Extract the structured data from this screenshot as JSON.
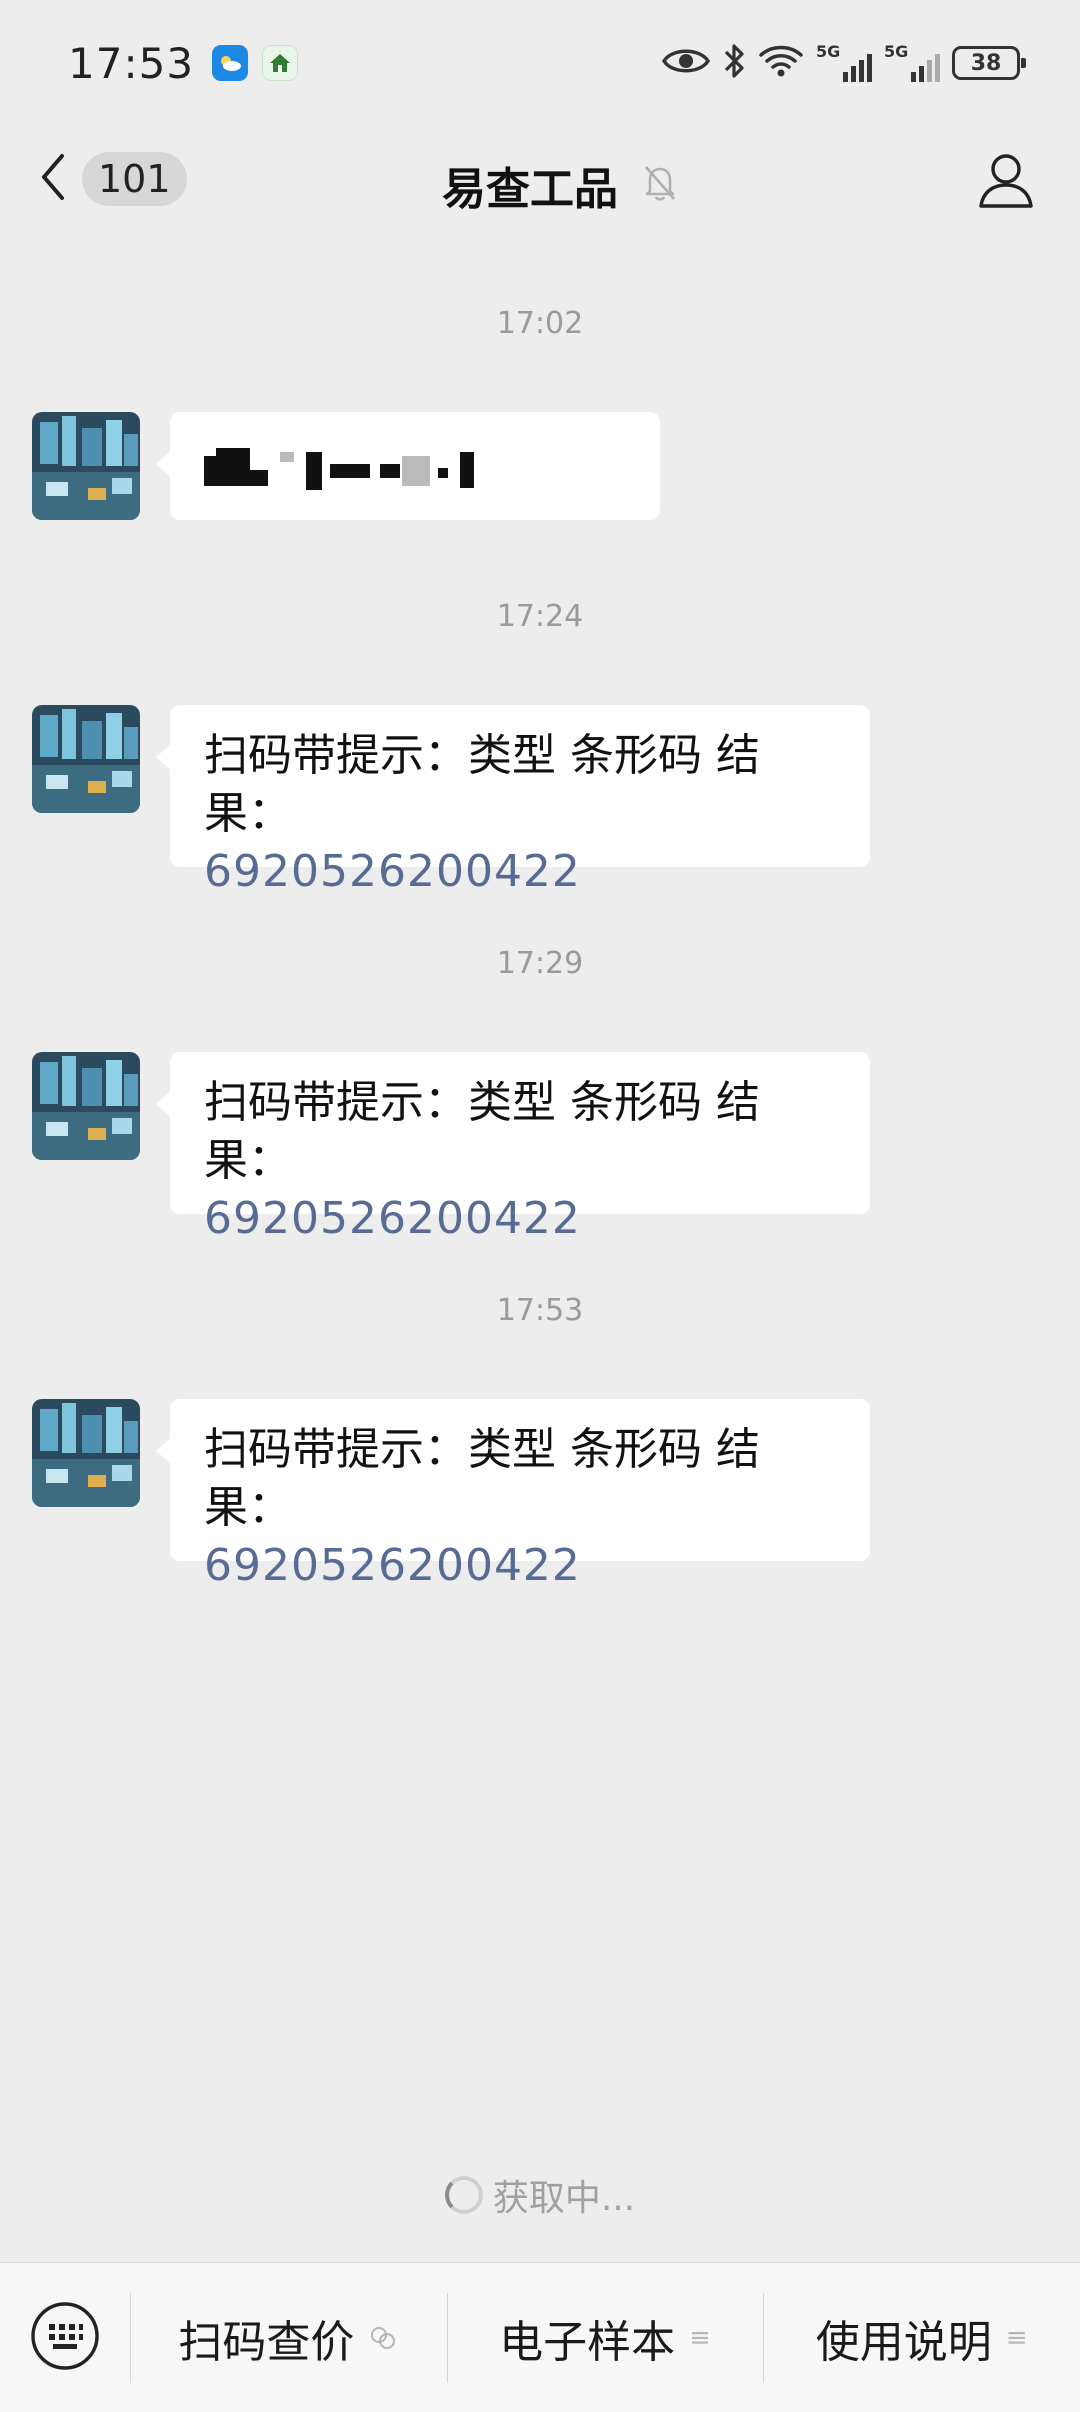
{
  "status_bar": {
    "time": "17:53",
    "signal_1_label": "5G",
    "signal_2_label": "5G",
    "battery": "38"
  },
  "header": {
    "unread_count": "101",
    "title": "易查工品"
  },
  "messages": [
    {
      "time": "17:02",
      "redacted": true
    },
    {
      "time": "17:24",
      "text": "扫码带提示：类型 条形码 结果：",
      "code": "6920526200422"
    },
    {
      "time": "17:29",
      "text": "扫码带提示：类型 条形码 结果：",
      "code": "6920526200422"
    },
    {
      "time": "17:53",
      "text": "扫码带提示：类型 条形码 结果：",
      "code": "6920526200422"
    }
  ],
  "loading_text": "获取中...",
  "bottom_menu": {
    "items": [
      {
        "label": "扫码查价",
        "icon": "link-icon"
      },
      {
        "label": "电子样本",
        "icon": "menu-lines-icon",
        "lines": "≡"
      },
      {
        "label": "使用说明",
        "icon": "menu-lines-icon",
        "lines": "≡"
      }
    ]
  },
  "colors": {
    "background": "#ededed",
    "bubble": "#ffffff",
    "link_number": "#576b95",
    "timestamp": "#9a9a9a"
  }
}
